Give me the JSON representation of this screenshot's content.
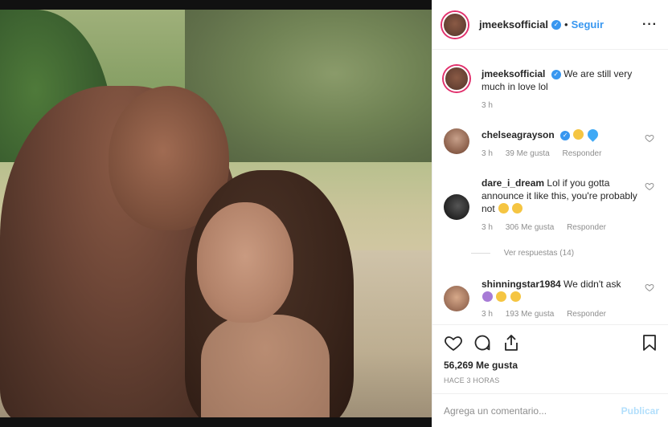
{
  "post": {
    "author": "jmeeksofficial",
    "follow_label": "Seguir",
    "separator": "•",
    "more_label": "···"
  },
  "caption": {
    "author": "jmeeksofficial",
    "text": "We are still very much in love lol",
    "time": "3 h"
  },
  "comments": [
    {
      "user": "chelseagrayson",
      "verified": true,
      "text": "",
      "emoji": [
        "raised-hands-emoji",
        "blue-heart-emoji"
      ],
      "time": "3 h",
      "likes": "39 Me gusta",
      "reply": "Responder"
    },
    {
      "user": "dare_i_dream",
      "text": "Lol if you gotta announce it like this, you're probably not",
      "emoji": [
        "grinning-sweat-emoji",
        "grinning-sweat-emoji"
      ],
      "time": "3 h",
      "likes": "306 Me gusta",
      "reply": "Responder",
      "view_replies": "Ver respuestas (14)"
    },
    {
      "user": "shinningstar1984",
      "text": "We didn't ask",
      "emoji": [
        "woman-shrugging-emoji",
        "crying-emoji",
        "rofl-emoji"
      ],
      "time": "3 h",
      "likes": "193 Me gusta",
      "reply": "Responder"
    }
  ],
  "actions": {
    "likes": "56,269 Me gusta",
    "time": "HACE 3 HORAS"
  },
  "add_comment": {
    "placeholder": "Agrega un comentario...",
    "post_label": "Publicar"
  },
  "colors": {
    "link_blue": "#3897f0",
    "post_disabled": "#b2dffc",
    "muted": "#8e8e8e",
    "text": "#262626"
  }
}
